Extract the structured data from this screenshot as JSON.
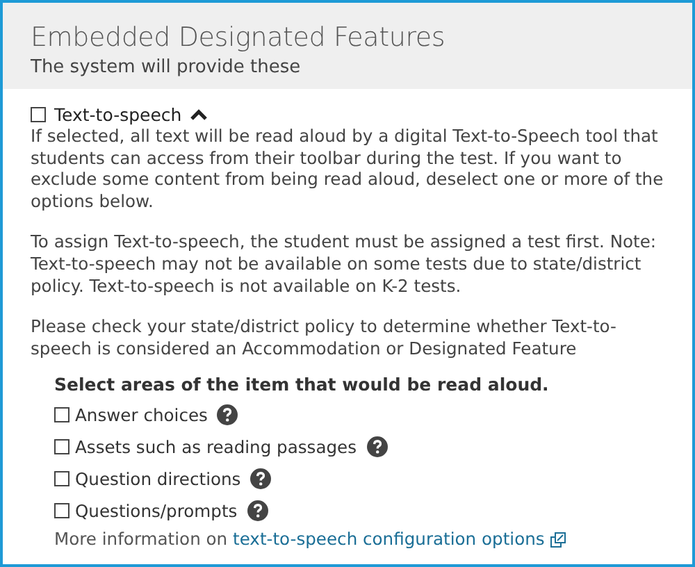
{
  "header": {
    "title": "Embedded Designated Features",
    "subtitle": "The system will provide these"
  },
  "feature": {
    "label": "Text-to-speech",
    "checked": false,
    "expanded": true
  },
  "paragraphs": [
    "If selected, all text will be read aloud by a digital Text-to-Speech tool that students can access from their toolbar during the test. If you want to exclude some content from being read aloud, deselect one or more of the options below.",
    "To assign Text-to-speech, the student must be assigned a test first. Note: Text-to-speech may not be available on some tests due to state/district policy. Text-to-speech is not available on K-2 tests.",
    "Please check your state/district policy to determine whether Text-to-speech is considered an Accommodation or Designated Feature"
  ],
  "areas": {
    "heading": "Select areas of the item that would be read aloud.",
    "options": [
      {
        "label": "Answer choices",
        "checked": false
      },
      {
        "label": "Assets such as reading passages",
        "checked": false
      },
      {
        "label": "Question directions",
        "checked": false
      },
      {
        "label": "Questions/prompts",
        "checked": false
      }
    ]
  },
  "more_info": {
    "text": "More information on",
    "link": "text-to-speech configuration options"
  }
}
